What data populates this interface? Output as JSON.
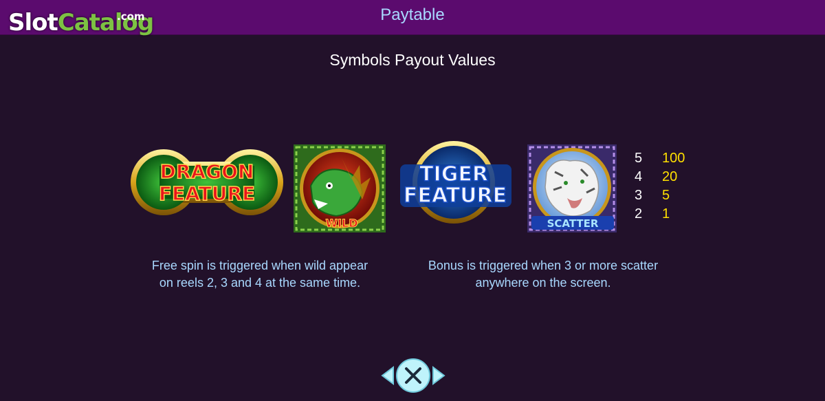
{
  "header": {
    "title": "Paytable",
    "logo_slot": "Slot",
    "logo_catalog": "Catalog",
    "logo_dotcom": ".com"
  },
  "section_title": "Symbols Payout Values",
  "symbols": {
    "dragon_feature": {
      "line1": "DRAGON",
      "line2": "FEATURE"
    },
    "wild": {
      "label": "WILD"
    },
    "tiger_feature": {
      "line1": "TIGER",
      "line2": "FEATURE"
    },
    "scatter": {
      "label": "SCATTER"
    }
  },
  "payouts": [
    {
      "count": "5",
      "amount": "100"
    },
    {
      "count": "4",
      "amount": "20"
    },
    {
      "count": "3",
      "amount": "5"
    },
    {
      "count": "2",
      "amount": "1"
    }
  ],
  "descriptions": {
    "wild_line1": "Free spin is triggered when wild appear",
    "wild_line2": "on reels 2, 3 and 4 at the same time.",
    "scatter_line1": "Bonus is triggered when 3 or more scatter",
    "scatter_line2": "anywhere on the screen."
  },
  "colors": {
    "header_bg": "#5b0b6e",
    "page_bg": "#22112a",
    "title_blue": "#a9d8ff",
    "payout_yellow": "#ffe000",
    "nav_cyan": "#bff3fb"
  },
  "icons": [
    "prev-arrow-icon",
    "close-icon",
    "next-arrow-icon"
  ]
}
